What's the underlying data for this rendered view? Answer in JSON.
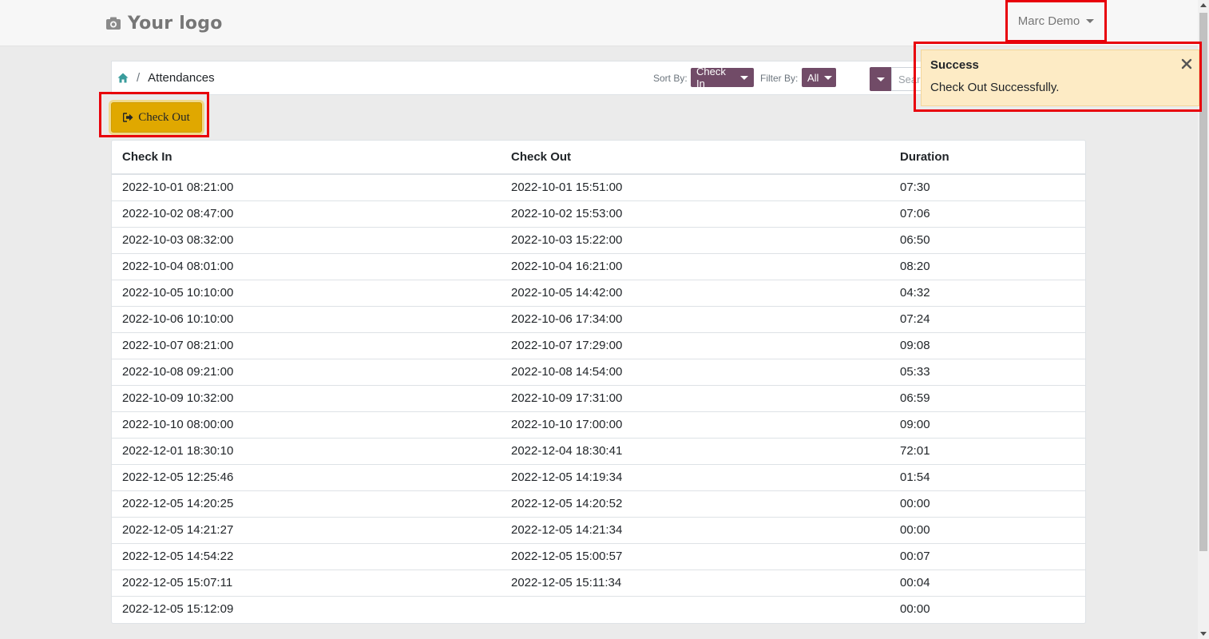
{
  "header": {
    "logo_text": "Your logo",
    "user_name": "Marc Demo"
  },
  "controls": {
    "breadcrumb_separator": "/",
    "breadcrumb_current": "Attendances",
    "sort_label": "Sort By:",
    "sort_value": "Check In",
    "filter_label": "Filter By:",
    "filter_value": "All",
    "search_placeholder": "Search..."
  },
  "actions": {
    "checkout_label": "Check Out"
  },
  "notification": {
    "title": "Success",
    "message": "Check Out Successfully."
  },
  "table": {
    "columns": [
      "Check In",
      "Check Out",
      "Duration"
    ],
    "rows": [
      [
        "2022-10-01 08:21:00",
        "2022-10-01 15:51:00",
        "07:30"
      ],
      [
        "2022-10-02 08:47:00",
        "2022-10-02 15:53:00",
        "07:06"
      ],
      [
        "2022-10-03 08:32:00",
        "2022-10-03 15:22:00",
        "06:50"
      ],
      [
        "2022-10-04 08:01:00",
        "2022-10-04 16:21:00",
        "08:20"
      ],
      [
        "2022-10-05 10:10:00",
        "2022-10-05 14:42:00",
        "04:32"
      ],
      [
        "2022-10-06 10:10:00",
        "2022-10-06 17:34:00",
        "07:24"
      ],
      [
        "2022-10-07 08:21:00",
        "2022-10-07 17:29:00",
        "09:08"
      ],
      [
        "2022-10-08 09:21:00",
        "2022-10-08 14:54:00",
        "05:33"
      ],
      [
        "2022-10-09 10:32:00",
        "2022-10-09 17:31:00",
        "06:59"
      ],
      [
        "2022-10-10 08:00:00",
        "2022-10-10 17:00:00",
        "09:00"
      ],
      [
        "2022-12-01 18:30:10",
        "2022-12-04 18:30:41",
        "72:01"
      ],
      [
        "2022-12-05 12:25:46",
        "2022-12-05 14:19:34",
        "01:54"
      ],
      [
        "2022-12-05 14:20:25",
        "2022-12-05 14:20:52",
        "00:00"
      ],
      [
        "2022-12-05 14:21:27",
        "2022-12-05 14:21:34",
        "00:00"
      ],
      [
        "2022-12-05 14:54:22",
        "2022-12-05 15:00:57",
        "00:07"
      ],
      [
        "2022-12-05 15:07:11",
        "2022-12-05 15:11:34",
        "00:04"
      ],
      [
        "2022-12-05 15:12:09",
        "",
        "00:00"
      ]
    ]
  },
  "colors": {
    "brand_purple": "#714b67",
    "checkout_yellow": "#e0a800",
    "highlight_red": "#e8000b",
    "toast_bg": "#fdebc5",
    "home_teal": "#3a9c9c"
  }
}
